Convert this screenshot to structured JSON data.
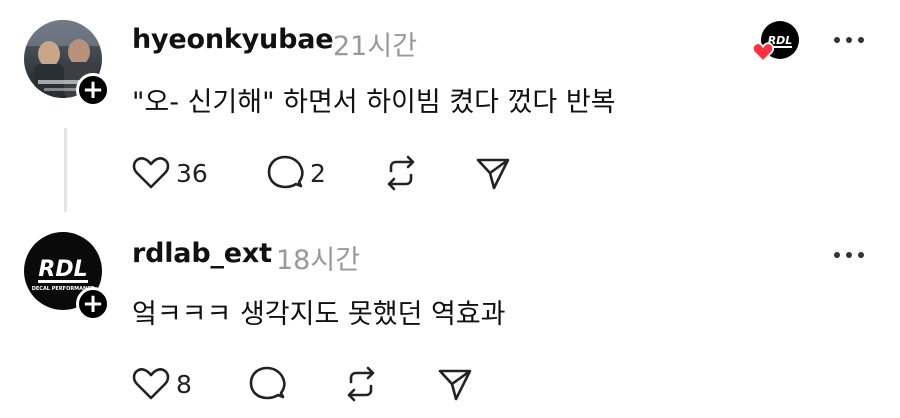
{
  "colors": {
    "background": "#ffffff",
    "text": "#111111",
    "muted": "#999999",
    "heart": "#ff3040",
    "thread_line": "#e4e4e4"
  },
  "posts": [
    {
      "username": "hyeonkyubae",
      "timestamp": "21시간",
      "text": "\"오- 신기해\" 하면서 하이빔 켰다 껐다 반복",
      "likes": "36",
      "replies": "2",
      "reposts": "",
      "avatar": "photo-avatar",
      "liked_by_badge": "RDL"
    },
    {
      "username": "rdlab_ext",
      "timestamp": "18시간",
      "text": "엌ㅋㅋㅋ 생각지도 못했던 역효과",
      "likes": "8",
      "replies": "",
      "reposts": "",
      "avatar": "rdl-logo-avatar",
      "avatar_logo": "RDL",
      "avatar_logo_sub": "DECAL PERFORMANCE"
    }
  ],
  "icons": {
    "like": "heart-icon",
    "reply": "comment-icon",
    "repost": "repost-icon",
    "share": "send-icon",
    "more": "more-icon",
    "follow": "plus-icon"
  }
}
